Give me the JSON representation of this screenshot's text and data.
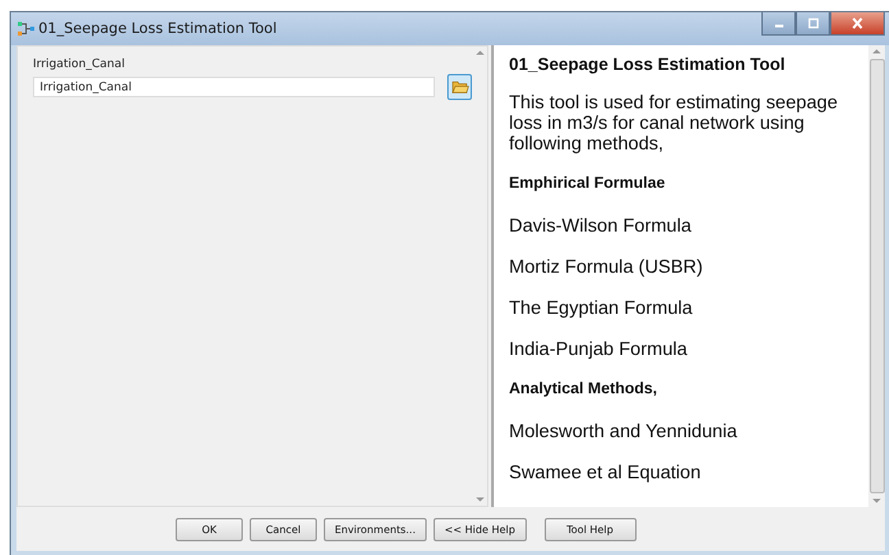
{
  "window": {
    "title": "01_Seepage Loss Estimation Tool"
  },
  "parameters": [
    {
      "label": "Irrigation_Canal",
      "value": "Irrigation_Canal"
    }
  ],
  "help": {
    "title": "01_Seepage Loss Estimation Tool",
    "items": [
      {
        "kind": "text",
        "text": "This tool is used for estimating seepage loss in m3/s for canal network using following methods,"
      },
      {
        "kind": "heading",
        "text": "Emphirical Formulae"
      },
      {
        "kind": "text",
        "text": "Davis-Wilson Formula"
      },
      {
        "kind": "text",
        "text": "Mortiz Formula (USBR)"
      },
      {
        "kind": "text",
        "text": "The Egyptian Formula"
      },
      {
        "kind": "text",
        "text": "India-Punjab Formula"
      },
      {
        "kind": "heading",
        "text": "Analytical Methods,"
      },
      {
        "kind": "text",
        "text": "Molesworth and Yennidunia"
      },
      {
        "kind": "text",
        "text": "Swamee et al Equation"
      }
    ]
  },
  "buttons": [
    {
      "label": "OK"
    },
    {
      "label": "Cancel"
    },
    {
      "label": "Environments..."
    },
    {
      "label": "<< Hide Help"
    },
    {
      "label": "Tool Help"
    }
  ]
}
